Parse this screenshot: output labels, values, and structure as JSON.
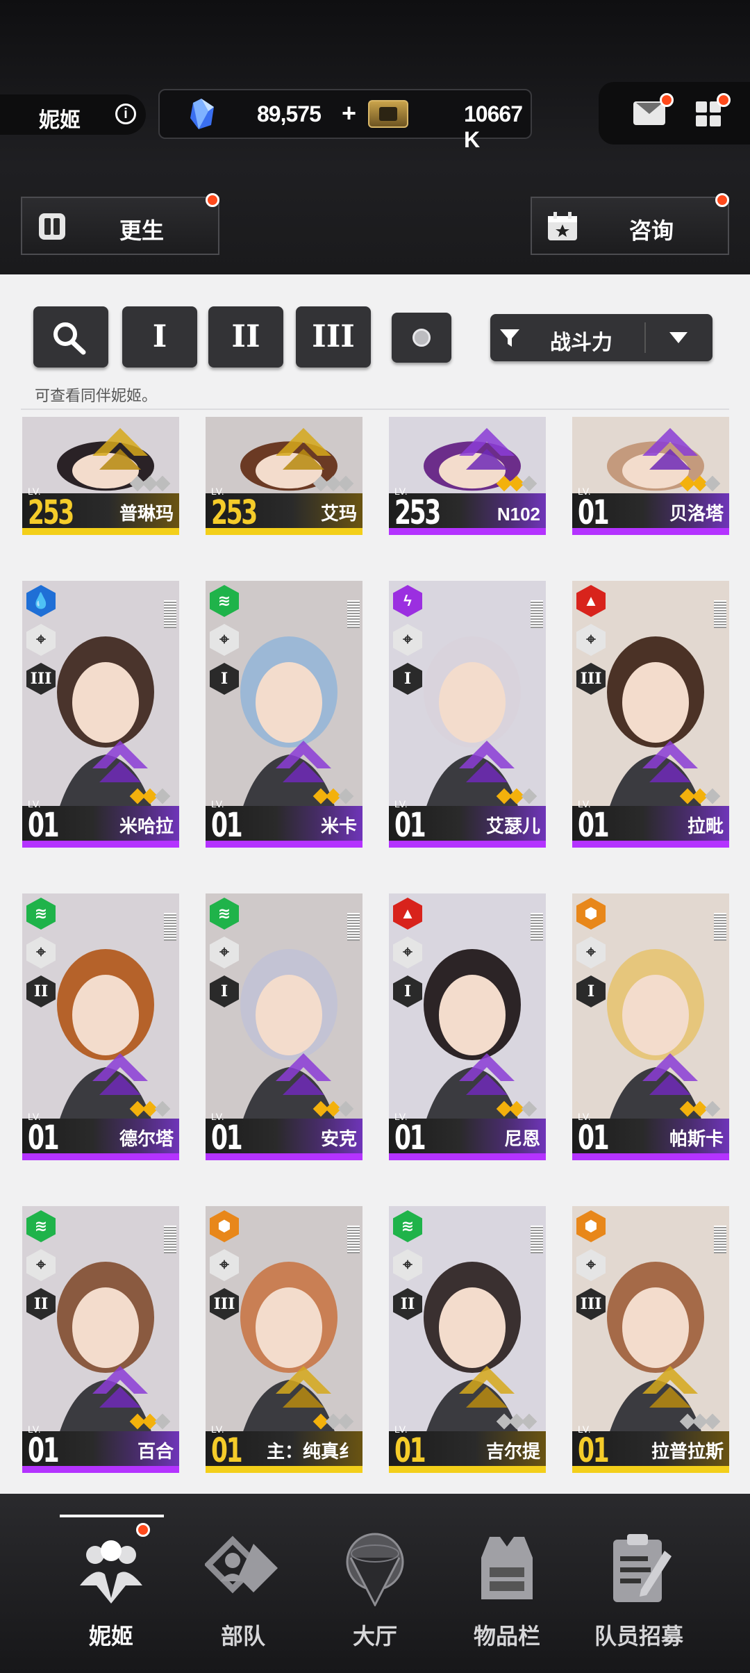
{
  "header": {
    "title": "妮姬",
    "info_icon": "i",
    "gems": "89,575",
    "gems_plus": "+",
    "credits": "10667 K",
    "rebirth_label": "更生",
    "consult_label": "咨询"
  },
  "filters": {
    "burst1": "I",
    "burst2": "II",
    "burst3": "III",
    "sort_label": "战斗力",
    "hint": "可查看同伴妮姬。"
  },
  "cards": [
    {
      "level": "253",
      "name": "普琳玛",
      "rarity": "gold",
      "stars": 0,
      "partial": true
    },
    {
      "level": "253",
      "name": "艾玛",
      "rarity": "gold",
      "stars": 0,
      "partial": true
    },
    {
      "level": "253",
      "name": "N102",
      "rarity": "purple",
      "stars": 2,
      "partial": true
    },
    {
      "level": "01",
      "name": "贝洛塔",
      "rarity": "purple",
      "stars": 2,
      "partial": true
    },
    {
      "level": "01",
      "name": "米哈拉",
      "rarity": "purple",
      "stars": 2,
      "element": "water",
      "burst": "III"
    },
    {
      "level": "01",
      "name": "米卡",
      "rarity": "purple",
      "stars": 2,
      "element": "wind",
      "burst": "I"
    },
    {
      "level": "01",
      "name": "艾瑟儿",
      "rarity": "purple",
      "stars": 2,
      "element": "electric",
      "burst": "I"
    },
    {
      "level": "01",
      "name": "拉毗",
      "rarity": "purple",
      "stars": 2,
      "element": "fire",
      "burst": "III"
    },
    {
      "level": "01",
      "name": "德尔塔",
      "rarity": "purple",
      "stars": 2,
      "element": "wind",
      "burst": "II"
    },
    {
      "level": "01",
      "name": "安克",
      "rarity": "purple",
      "stars": 2,
      "element": "wind",
      "burst": "I"
    },
    {
      "level": "01",
      "name": "尼恩",
      "rarity": "purple",
      "stars": 2,
      "element": "fire",
      "burst": "I"
    },
    {
      "level": "01",
      "name": "帕斯卡",
      "rarity": "purple",
      "stars": 2,
      "element": "iron",
      "burst": "I"
    },
    {
      "level": "01",
      "name": "百合",
      "rarity": "purple",
      "stars": 2,
      "element": "wind",
      "burst": "II"
    },
    {
      "level": "01",
      "name": "主：纯真纟",
      "rarity": "gold",
      "stars": 1,
      "element": "iron",
      "burst": "III"
    },
    {
      "level": "01",
      "name": "吉尔提",
      "rarity": "gold",
      "stars": 0,
      "element": "wind",
      "burst": "II"
    },
    {
      "level": "01",
      "name": "拉普拉斯",
      "rarity": "gold",
      "stars": 0,
      "element": "iron",
      "burst": "III"
    }
  ],
  "lv_label": "LV.",
  "nav": {
    "items": [
      "妮姬",
      "部队",
      "大厅",
      "物品栏",
      "队员招募"
    ]
  },
  "colors": {
    "accent_purple": "#b433ff",
    "accent_gold": "#f3cf1a",
    "badge_red": "#ff4a1c"
  }
}
